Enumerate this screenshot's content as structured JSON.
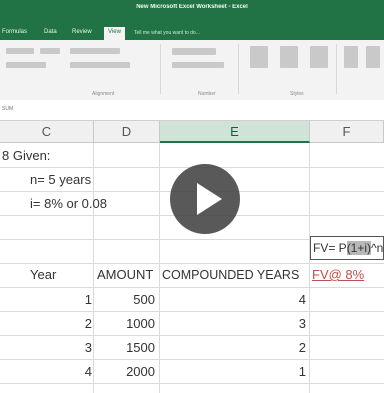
{
  "window": {
    "title": "New Microsoft Excel Worksheet - Excel"
  },
  "ribbon_tabs": [
    "Formulas",
    "Data",
    "Review",
    "View"
  ],
  "tell_me_placeholder": "Tell me what you want to do...",
  "ribbon_groups": [
    "Alignment",
    "Number",
    "Styles"
  ],
  "name_box": "SUM",
  "columns": [
    "C",
    "D",
    "E",
    "F"
  ],
  "cells": {
    "given": "8 Given:",
    "n_value": "n= 5 years",
    "i_value": "i= 8% or 0.08",
    "fv_formula_prefix": "FV= P",
    "fv_formula_highlight": "(1+i)",
    "fv_formula_suffix": "^n",
    "header_year": "Year",
    "header_amount": "AMOUNT",
    "header_compounded": "COMPOUNDED YEARS",
    "header_fv": "FV@ 8%"
  },
  "rows": [
    {
      "year": "1",
      "amount": "500",
      "compounded": "4"
    },
    {
      "year": "2",
      "amount": "1000",
      "compounded": "3"
    },
    {
      "year": "3",
      "amount": "1500",
      "compounded": "2"
    },
    {
      "year": "4",
      "amount": "2000",
      "compounded": "1"
    }
  ],
  "colors": {
    "excel_green": "#217346",
    "link_red": "#c0504d"
  },
  "overlay": {
    "icon": "play-icon"
  }
}
